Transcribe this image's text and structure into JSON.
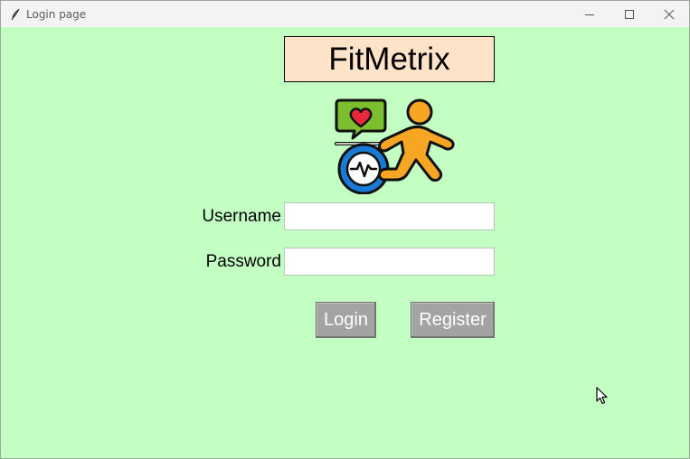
{
  "window": {
    "title": "Login page",
    "icons": {
      "app": "feather-icon",
      "minimize": "minimize-icon",
      "maximize": "maximize-icon",
      "close": "close-icon"
    }
  },
  "brand": {
    "name": "FitMetrix",
    "logo_icon": "fitness-runner-heart-icon",
    "colors": {
      "background": "#c3ffc3",
      "title_box": "#fde3c8",
      "button": "#a3a3a3"
    }
  },
  "form": {
    "username_label": "Username",
    "username_value": "",
    "password_label": "Password",
    "password_value": ""
  },
  "buttons": {
    "login_label": "Login",
    "register_label": "Register"
  }
}
